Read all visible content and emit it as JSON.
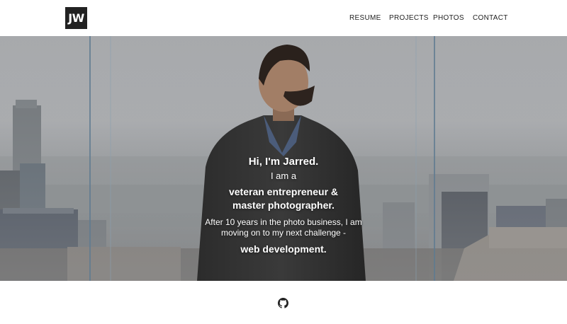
{
  "header": {
    "logo_text": "JW",
    "nav": [
      {
        "label": "RESUME"
      },
      {
        "label": "PROJECTS"
      },
      {
        "label": "PHOTOS"
      },
      {
        "label": "CONTACT"
      }
    ]
  },
  "hero": {
    "greeting": "Hi, I'm Jarred.",
    "intro": "I am a",
    "role": "veteran entrepreneur & master photographer.",
    "story": "After 10 years in the photo business, I am moving on to my next challenge -",
    "highlight": "web development."
  },
  "footer": {
    "icon": "github-icon"
  },
  "colors": {
    "logo_bg": "#222222",
    "nav_text": "#222222",
    "hero_text": "#ffffff"
  }
}
